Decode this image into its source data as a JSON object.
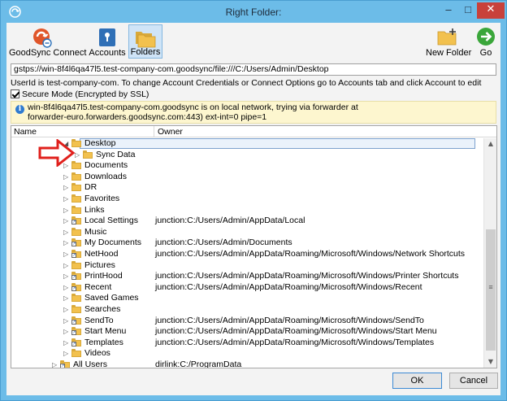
{
  "window": {
    "title": "Right Folder:",
    "controls": {
      "minimize": "–",
      "maximize": "□",
      "close": "✕"
    }
  },
  "toolbar": {
    "goodsync_connect": "GoodSync Connect",
    "accounts": "Accounts",
    "folders": "Folders",
    "new_folder": "New Folder",
    "go": "Go"
  },
  "path": {
    "value": "gstps://win-8f4l6qa47l5.test-company-com.goodsync/file:///C:/Users/Admin/Desktop"
  },
  "userid_note": "UserId is test-company-com. To change Account Credentials or Connect Options go to Accounts tab and click Account to edit",
  "secure_mode": {
    "label": "Secure Mode (Encrypted by SSL)",
    "checked": true
  },
  "info": {
    "line1": "win-8f4l6qa47l5.test-company-com.goodsync is on local network, trying via forwarder at",
    "line2": "forwarder-euro.forwarders.goodsync.com:443) ext-int=0 pipe=1"
  },
  "tree": {
    "columns": {
      "name": "Name",
      "owner": "Owner"
    },
    "rows": [
      {
        "name": "Desktop",
        "owner": "",
        "level": 1,
        "expanded": true,
        "selected": true,
        "link": false
      },
      {
        "name": "Sync Data",
        "owner": "",
        "level": 2,
        "expanded": false,
        "selected": false,
        "link": false
      },
      {
        "name": "Documents",
        "owner": "",
        "level": 1,
        "expanded": false,
        "selected": false,
        "link": false
      },
      {
        "name": "Downloads",
        "owner": "",
        "level": 1,
        "expanded": false,
        "selected": false,
        "link": false
      },
      {
        "name": "DR",
        "owner": "",
        "level": 1,
        "expanded": false,
        "selected": false,
        "link": false
      },
      {
        "name": "Favorites",
        "owner": "",
        "level": 1,
        "expanded": false,
        "selected": false,
        "link": false
      },
      {
        "name": "Links",
        "owner": "",
        "level": 1,
        "expanded": false,
        "selected": false,
        "link": false
      },
      {
        "name": "Local Settings",
        "owner": "junction:C:/Users/Admin/AppData/Local",
        "level": 1,
        "expanded": false,
        "selected": false,
        "link": true
      },
      {
        "name": "Music",
        "owner": "",
        "level": 1,
        "expanded": false,
        "selected": false,
        "link": false
      },
      {
        "name": "My Documents",
        "owner": "junction:C:/Users/Admin/Documents",
        "level": 1,
        "expanded": false,
        "selected": false,
        "link": true
      },
      {
        "name": "NetHood",
        "owner": "junction:C:/Users/Admin/AppData/Roaming/Microsoft/Windows/Network Shortcuts",
        "level": 1,
        "expanded": false,
        "selected": false,
        "link": true
      },
      {
        "name": "Pictures",
        "owner": "",
        "level": 1,
        "expanded": false,
        "selected": false,
        "link": false
      },
      {
        "name": "PrintHood",
        "owner": "junction:C:/Users/Admin/AppData/Roaming/Microsoft/Windows/Printer Shortcuts",
        "level": 1,
        "expanded": false,
        "selected": false,
        "link": true
      },
      {
        "name": "Recent",
        "owner": "junction:C:/Users/Admin/AppData/Roaming/Microsoft/Windows/Recent",
        "level": 1,
        "expanded": false,
        "selected": false,
        "link": true
      },
      {
        "name": "Saved Games",
        "owner": "",
        "level": 1,
        "expanded": false,
        "selected": false,
        "link": false
      },
      {
        "name": "Searches",
        "owner": "",
        "level": 1,
        "expanded": false,
        "selected": false,
        "link": false
      },
      {
        "name": "SendTo",
        "owner": "junction:C:/Users/Admin/AppData/Roaming/Microsoft/Windows/SendTo",
        "level": 1,
        "expanded": false,
        "selected": false,
        "link": true
      },
      {
        "name": "Start Menu",
        "owner": "junction:C:/Users/Admin/AppData/Roaming/Microsoft/Windows/Start Menu",
        "level": 1,
        "expanded": false,
        "selected": false,
        "link": true
      },
      {
        "name": "Templates",
        "owner": "junction:C:/Users/Admin/AppData/Roaming/Microsoft/Windows/Templates",
        "level": 1,
        "expanded": false,
        "selected": false,
        "link": true
      },
      {
        "name": "Videos",
        "owner": "",
        "level": 1,
        "expanded": false,
        "selected": false,
        "link": false
      },
      {
        "name": "All Users",
        "owner": "dirlink:C:/ProgramData",
        "level": 0,
        "expanded": false,
        "selected": false,
        "link": true
      }
    ]
  },
  "buttons": {
    "ok": "OK",
    "cancel": "Cancel"
  },
  "colors": {
    "titlebar": "#6cbce8",
    "close_button": "#c8413b",
    "info_banner": "#fdf6cf",
    "annotation_arrow": "#e0201c",
    "folder": "#f2c14e"
  }
}
